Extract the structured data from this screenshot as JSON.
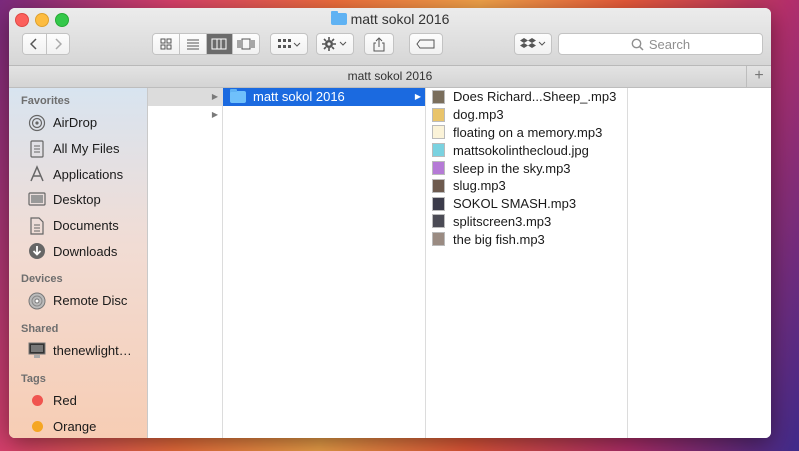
{
  "window": {
    "title": "matt sokol 2016"
  },
  "toolbar": {
    "back_icon": "chevron-left-icon",
    "forward_icon": "chevron-right-icon",
    "view_modes": [
      "icon-view-icon",
      "list-view-icon",
      "column-view-icon",
      "coverflow-view-icon"
    ],
    "active_view": "column-view-icon",
    "search_placeholder": "Search"
  },
  "pathbar": {
    "label": "matt sokol 2016",
    "add_label": "+"
  },
  "sidebar": {
    "favorites_header": "Favorites",
    "favorites": [
      {
        "label": "AirDrop",
        "icon": "airdrop-icon"
      },
      {
        "label": "All My Files",
        "icon": "all-files-icon"
      },
      {
        "label": "Applications",
        "icon": "applications-icon"
      },
      {
        "label": "Desktop",
        "icon": "desktop-icon"
      },
      {
        "label": "Documents",
        "icon": "documents-icon"
      },
      {
        "label": "Downloads",
        "icon": "downloads-icon"
      }
    ],
    "devices_header": "Devices",
    "devices": [
      {
        "label": "Remote Disc",
        "icon": "disc-icon"
      }
    ],
    "shared_header": "Shared",
    "shared": [
      {
        "label": "thenewlight…",
        "icon": "display-icon"
      }
    ],
    "tags_header": "Tags",
    "tags": [
      {
        "label": "Red",
        "color": "#f0544f"
      },
      {
        "label": "Orange",
        "color": "#f5a623"
      }
    ]
  },
  "columns": {
    "col2": {
      "selected_label": "matt sokol 2016"
    },
    "files": [
      {
        "name": "Does Richard...Sheep_.mp3",
        "thumb": "#7a6e5c"
      },
      {
        "name": "dog.mp3",
        "thumb": "#e9c46a"
      },
      {
        "name": "floating on a memory.mp3",
        "thumb": "#fbf3d8"
      },
      {
        "name": "mattsokolinthecloud.jpg",
        "thumb": "#7ad2e0"
      },
      {
        "name": "sleep in the sky.mp3",
        "thumb": "#b57ad6"
      },
      {
        "name": "slug.mp3",
        "thumb": "#6d5a4e"
      },
      {
        "name": "SOKOL SMASH.mp3",
        "thumb": "#3b3b4a"
      },
      {
        "name": "splitscreen3.mp3",
        "thumb": "#4b4b55"
      },
      {
        "name": "the big fish.mp3",
        "thumb": "#9a8b82"
      }
    ]
  }
}
